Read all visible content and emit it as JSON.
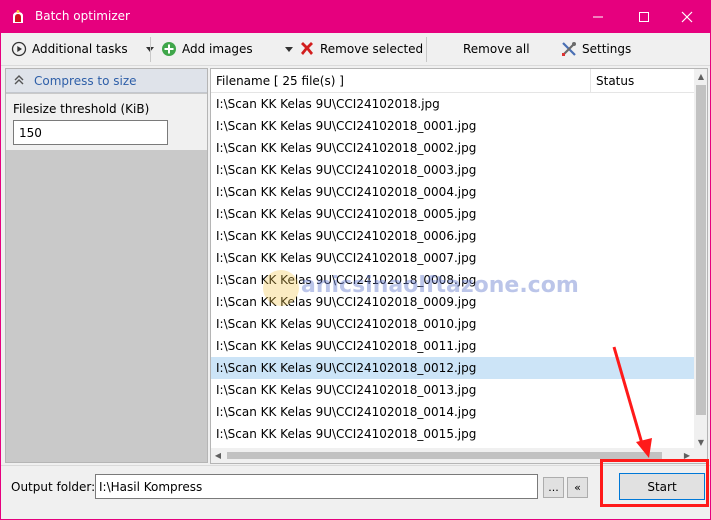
{
  "window": {
    "title": "Batch optimizer",
    "accent_color": "#e6007e",
    "controls": {
      "minimize": "—",
      "maximize": "☐",
      "close": "✕"
    }
  },
  "toolbar": {
    "additional_tasks": "Additional tasks",
    "add_images": "Add images",
    "remove_selected": "Remove selected",
    "remove_all": "Remove all",
    "settings": "Settings"
  },
  "left_panel": {
    "header": "Compress to size",
    "threshold_label": "Filesize threshold (KiB)",
    "threshold_value": "150"
  },
  "file_list": {
    "filename_header": "Filename [ 25 file(s) ]",
    "status_header": "Status",
    "selected_index": 12,
    "files": [
      "I:\\Scan KK Kelas 9U\\CCI24102018.jpg",
      "I:\\Scan KK Kelas 9U\\CCI24102018_0001.jpg",
      "I:\\Scan KK Kelas 9U\\CCI24102018_0002.jpg",
      "I:\\Scan KK Kelas 9U\\CCI24102018_0003.jpg",
      "I:\\Scan KK Kelas 9U\\CCI24102018_0004.jpg",
      "I:\\Scan KK Kelas 9U\\CCI24102018_0005.jpg",
      "I:\\Scan KK Kelas 9U\\CCI24102018_0006.jpg",
      "I:\\Scan KK Kelas 9U\\CCI24102018_0007.jpg",
      "I:\\Scan KK Kelas 9U\\CCI24102018_0008.jpg",
      "I:\\Scan KK Kelas 9U\\CCI24102018_0009.jpg",
      "I:\\Scan KK Kelas 9U\\CCI24102018_0010.jpg",
      "I:\\Scan KK Kelas 9U\\CCI24102018_0011.jpg",
      "I:\\Scan KK Kelas 9U\\CCI24102018_0012.jpg",
      "I:\\Scan KK Kelas 9U\\CCI24102018_0013.jpg",
      "I:\\Scan KK Kelas 9U\\CCI24102018_0014.jpg",
      "I:\\Scan KK Kelas 9U\\CCI24102018_0015.jpg"
    ]
  },
  "watermark": {
    "text": "anicsinaolftazone.com"
  },
  "bottom": {
    "output_label": "Output folder:",
    "output_value": "I:\\Hasil Kompress",
    "browse_label": "...",
    "back_label": "«",
    "start_label": "Start"
  },
  "annotation_color": "#ff1a1a"
}
